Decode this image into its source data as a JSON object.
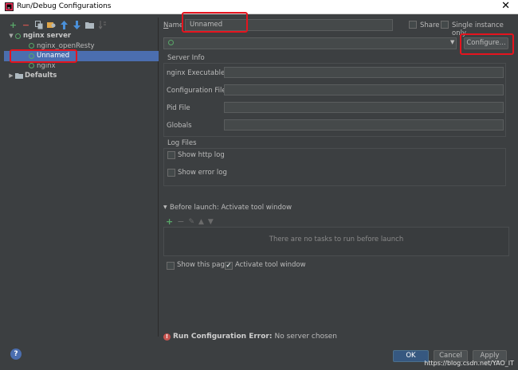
{
  "window": {
    "title": "Run/Debug Configurations"
  },
  "toolbar": {
    "icons": [
      "add-icon",
      "remove-icon",
      "copy-icon",
      "settings-icon",
      "move-up-icon",
      "move-down-icon",
      "folder-icon",
      "sort-icon"
    ],
    "add": "+",
    "remove": "−"
  },
  "tree": {
    "group": "nginx server",
    "items": [
      "nginx_openResty",
      "Unnamed",
      "nginx"
    ],
    "defaults": "Defaults"
  },
  "form": {
    "name_label": "Name",
    "name_value": "Unnamed",
    "share_label": "Share",
    "single_instance_label": "Single instance only",
    "server_placeholder": "",
    "configure_label": "Configure...",
    "server_info_title": "Server Info",
    "fields": [
      {
        "label": "nginx Executable",
        "value": ""
      },
      {
        "label": "Configuration File",
        "value": ""
      },
      {
        "label": "Pid File",
        "value": ""
      },
      {
        "label": "Globals",
        "value": ""
      }
    ],
    "log_files_title": "Log Files",
    "show_http_log": "Show http log",
    "show_error_log": "Show error log",
    "before_launch_title": "Before launch: Activate tool window",
    "no_tasks": "There are no tasks to run before launch",
    "show_this_page": "Show this page",
    "activate_tool_window": "Activate tool window",
    "error_prefix": "Run Configuration Error:",
    "error_message": "No server chosen"
  },
  "buttons": {
    "ok": "OK",
    "cancel": "Cancel",
    "apply": "Apply",
    "help": "?"
  },
  "watermark": "https://blog.csdn.net/YAO_IT",
  "colors": {
    "background": "#3c3f41",
    "selection": "#4b6eaf",
    "accent_green": "#59a869",
    "highlight_red": "#e5141e",
    "error_red": "#c75450"
  }
}
